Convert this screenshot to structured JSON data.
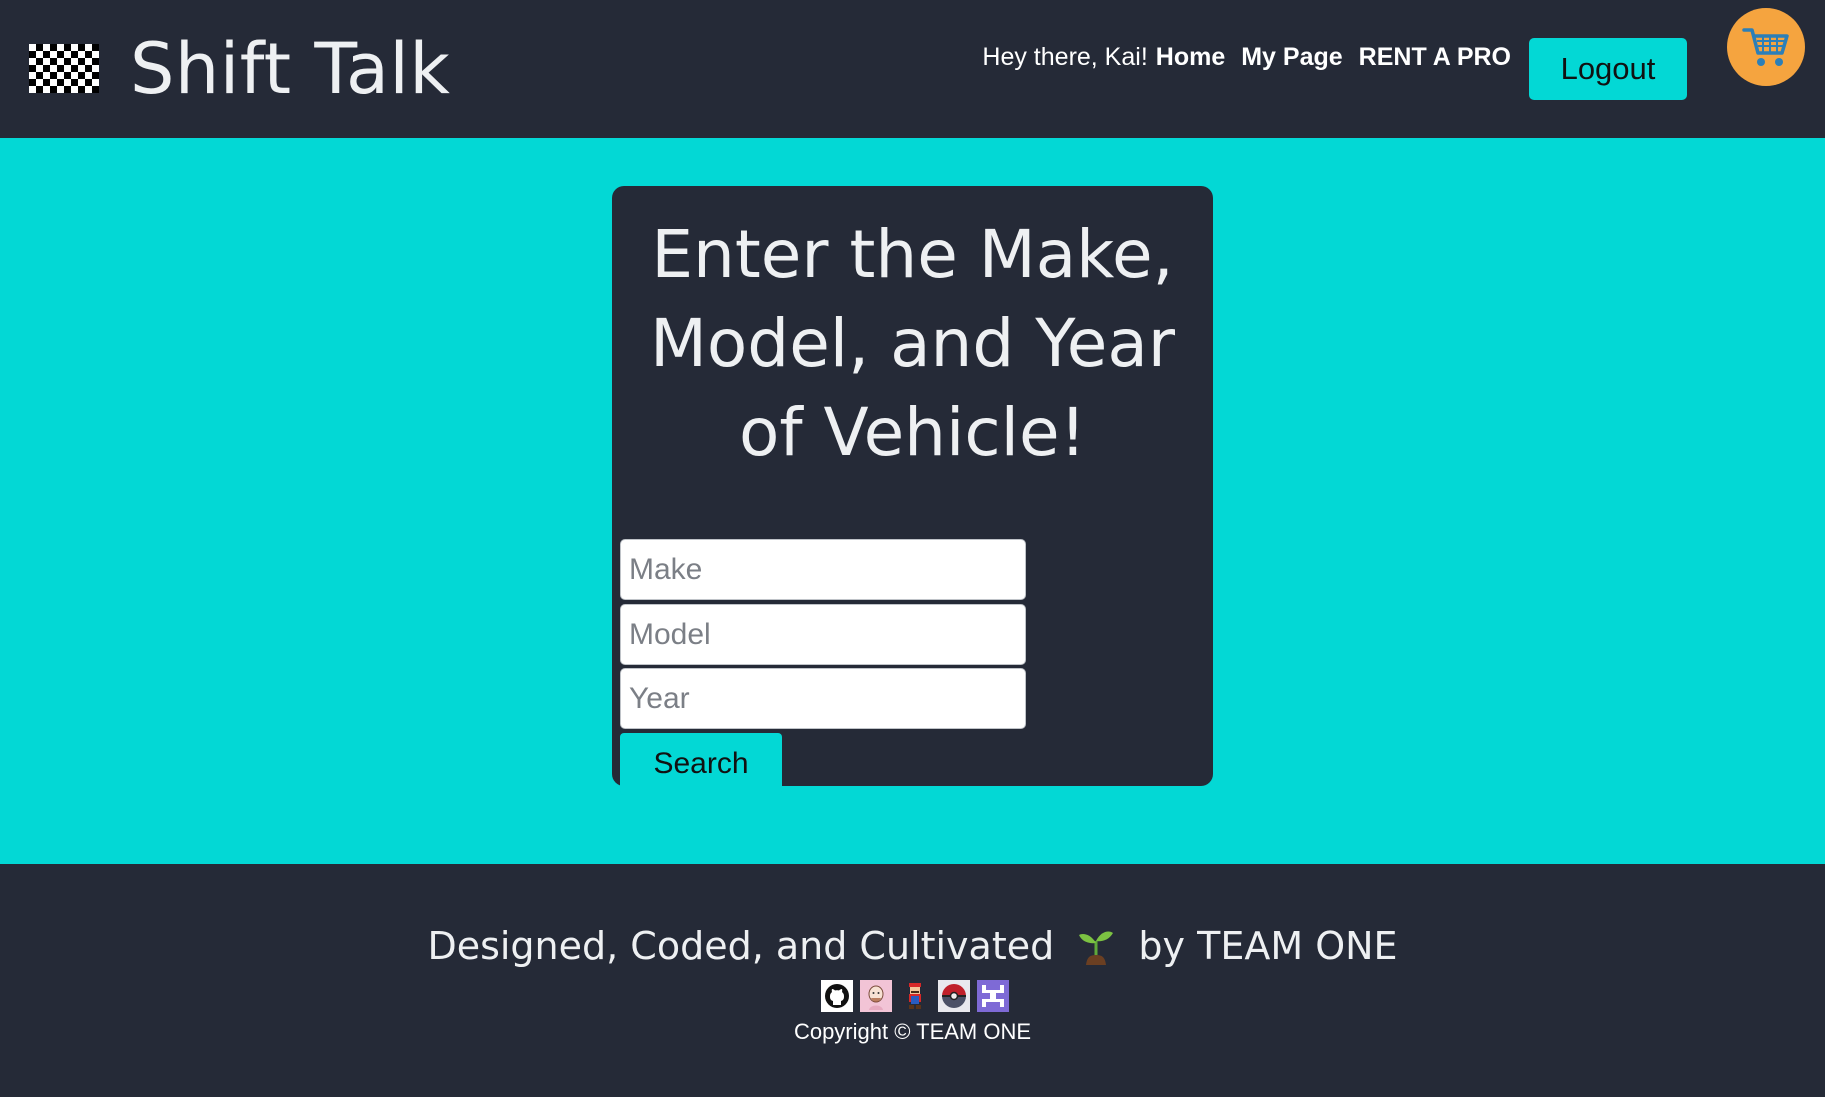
{
  "header": {
    "brand": "Shift Talk",
    "greeting": "Hey there, Kai!",
    "nav": {
      "home": "Home",
      "my_page": "My Page",
      "rent_a_pro": "RENT A PRO"
    },
    "logout_label": "Logout",
    "cart_icon": "shopping-cart-icon"
  },
  "search_card": {
    "title": "Enter the Make, Model, and Year of Vehicle!",
    "make_placeholder": "Make",
    "model_placeholder": "Model",
    "year_placeholder": "Year",
    "search_label": "Search"
  },
  "footer": {
    "tagline_start": "Designed, Coded, and Cultivated",
    "tagline_end": "by TEAM ONE",
    "sprout_icon": "seedling-icon",
    "copyright": "Copyright © TEAM ONE",
    "badges": [
      "github-icon",
      "avatar-face-icon",
      "mario-icon",
      "pokeball-icon",
      "pixel-logo-icon"
    ]
  },
  "colors": {
    "dark": "#252a37",
    "accent": "#03d8d5",
    "cart": "#f5a43f",
    "text": "#eef0f2"
  }
}
